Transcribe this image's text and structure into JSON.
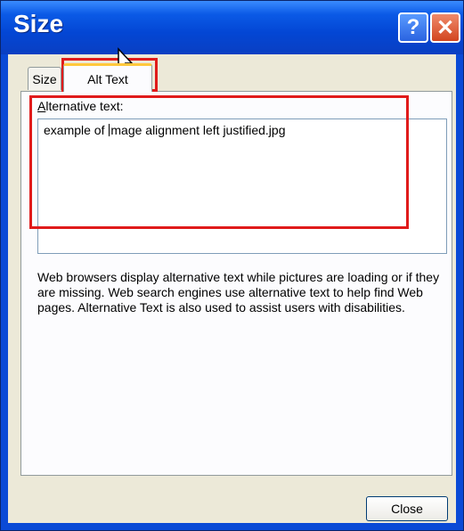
{
  "window": {
    "title": "Size"
  },
  "titlebar": {
    "help_label": "?",
    "close_label": "✕"
  },
  "tabs": [
    {
      "label": "Size",
      "selected": false
    },
    {
      "label": "Alt Text",
      "selected": true
    }
  ],
  "alt_text": {
    "field_label_accel": "A",
    "field_label_rest": "lternative text:",
    "value_before_caret": "example of ",
    "value_after_caret": "mage alignment left justified.jpg"
  },
  "description": "Web browsers display alternative text while pictures are loading or if they are missing.  Web search engines use alternative text to help find Web pages.  Alternative Text is also used to assist users with disabilities.",
  "buttons": {
    "close_label": "Close"
  },
  "colors": {
    "highlight": "#e01b1b",
    "titlebar": "#0346d4",
    "dialog_bg": "#ece9d8"
  },
  "icons": [
    "help-icon",
    "close-icon",
    "mouse-pointer-icon"
  ]
}
